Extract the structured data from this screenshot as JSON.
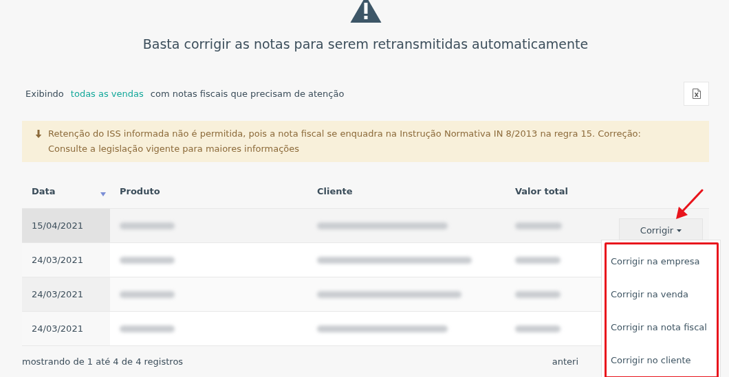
{
  "heading": "Basta corrigir as notas para serem retransmitidas automaticamente",
  "filter": {
    "prefix": "Exibindo",
    "link": "todas as vendas",
    "suffix": "com notas fiscais que precisam de atenção"
  },
  "alert": {
    "text": "Retenção do ISS informada não é permitida, pois a nota fiscal se enquadra na Instrução Normativa IN 8/2013 na regra 15. Correção: Consulte a legislação vigente para maiores informações"
  },
  "table": {
    "columns": [
      {
        "label": "Data",
        "sorted": true
      },
      {
        "label": "Produto",
        "sorted": false
      },
      {
        "label": "Cliente",
        "sorted": false
      },
      {
        "label": "Valor total",
        "sorted": false
      }
    ],
    "rows": [
      {
        "date": "15/04/2021",
        "hovered": true
      },
      {
        "date": "24/03/2021",
        "hovered": false
      },
      {
        "date": "24/03/2021",
        "hovered": false
      },
      {
        "date": "24/03/2021",
        "hovered": false
      }
    ]
  },
  "row_action": {
    "label": "Corrigir",
    "expanded": true,
    "menu": [
      "Corrigir na empresa",
      "Corrigir na venda",
      "Corrigir na nota fiscal",
      "Corrigir no cliente"
    ]
  },
  "footer": {
    "info": "mostrando de 1 até 4 de 4 registros",
    "pagination": "anteri"
  }
}
